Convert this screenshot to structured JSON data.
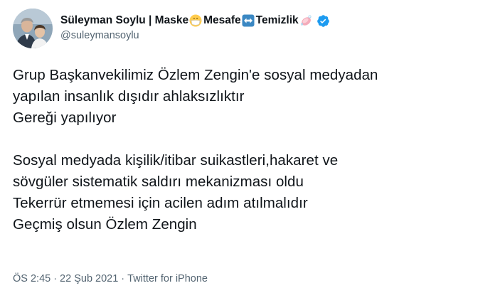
{
  "author": {
    "name_parts": [
      "Süleyman Soylu | Maske",
      "Mesafe",
      "Temizlik"
    ],
    "handle": "@suleymansoylu",
    "icons": [
      "avatar-photo",
      "face-with-medical-mask-emoji",
      "left-right-arrow-emoji",
      "soap-emoji",
      "verified-badge-icon"
    ],
    "verified_color": "#1d9bf0"
  },
  "tweet": {
    "text": "Grup Başkanvekilimiz Özlem Zengin'e sosyal medyadan\nyapılan insanlık dışıdır ahlaksızlıktır\nGereği yapılıyor\n\nSosyal medyada kişilik/itibar suikastleri,hakaret ve\nsövgüler sistematik saldırı mekanizması oldu\nTekerrür etmemesi için acilen adım atılmalıdır\nGeçmiş olsun Özlem Zengin"
  },
  "meta": {
    "time": "ÖS 2:45",
    "separator": "·",
    "date": "22 Şub 2021",
    "source": "Twitter for iPhone"
  }
}
